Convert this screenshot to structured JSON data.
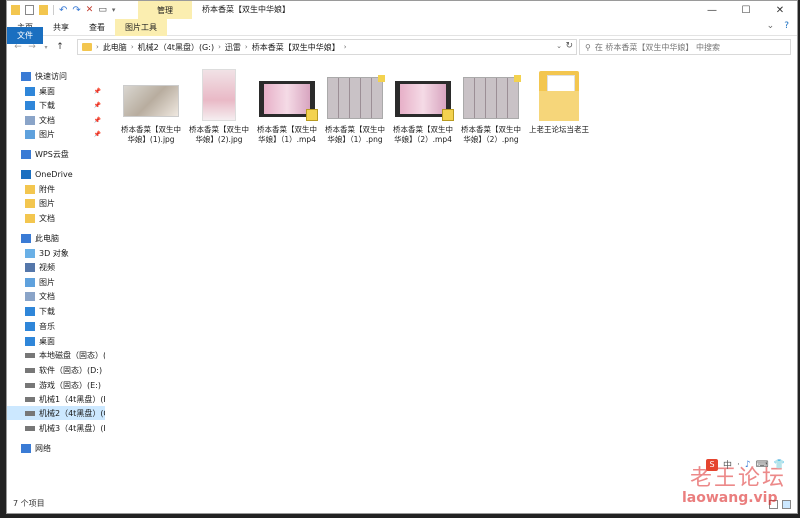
{
  "titlebar": {
    "manage_tab": "管理",
    "title": "桥本香菜【双生中华娘】",
    "minimize": "—",
    "maximize": "☐",
    "close": "✕"
  },
  "ribbon": {
    "tabs": [
      "文件",
      "主页",
      "共享",
      "查看",
      "图片工具"
    ]
  },
  "address": {
    "crumbs": [
      "此电脑",
      "机械2（4t黑盘）(G:)",
      "迅雷",
      "桥本香菜【双生中华娘】"
    ],
    "search_placeholder": "在 桥本香菜【双生中华娘】 中搜索"
  },
  "sidebar": {
    "items": [
      {
        "label": "快速访问",
        "icon": "star-icon",
        "pinned": false
      },
      {
        "label": "桌面",
        "icon": "desktop-icon",
        "pinned": true
      },
      {
        "label": "下载",
        "icon": "download-icon",
        "pinned": true
      },
      {
        "label": "文档",
        "icon": "document-icon",
        "pinned": true
      },
      {
        "label": "图片",
        "icon": "picture-icon",
        "pinned": true
      },
      {
        "label": "WPS云盘",
        "icon": "cloud-icon",
        "pinned": false
      },
      {
        "label": "OneDrive",
        "icon": "onedrive-icon",
        "pinned": false
      },
      {
        "label": "附件",
        "icon": "folder-icon",
        "pinned": false
      },
      {
        "label": "图片",
        "icon": "folder-icon",
        "pinned": false
      },
      {
        "label": "文档",
        "icon": "folder-icon",
        "pinned": false
      },
      {
        "label": "此电脑",
        "icon": "computer-icon",
        "pinned": false
      },
      {
        "label": "3D 对象",
        "icon": "cube-icon",
        "pinned": false
      },
      {
        "label": "视频",
        "icon": "video-icon",
        "pinned": false
      },
      {
        "label": "图片",
        "icon": "picture-icon",
        "pinned": false
      },
      {
        "label": "文档",
        "icon": "document-icon",
        "pinned": false
      },
      {
        "label": "下载",
        "icon": "download-icon",
        "pinned": false
      },
      {
        "label": "音乐",
        "icon": "music-icon",
        "pinned": false
      },
      {
        "label": "桌面",
        "icon": "desktop-icon",
        "pinned": false
      },
      {
        "label": "本地磁盘（固态）(",
        "icon": "drive-icon",
        "pinned": false
      },
      {
        "label": "软件（固态）(D:)",
        "icon": "drive-icon",
        "pinned": false
      },
      {
        "label": "游戏（固态）(E:)",
        "icon": "drive-icon",
        "pinned": false
      },
      {
        "label": "机械1（4t黑盘）(F",
        "icon": "drive-icon",
        "pinned": false
      },
      {
        "label": "机械2（4t黑盘）(G",
        "icon": "drive-icon",
        "pinned": false
      },
      {
        "label": "机械3（4t黑盘）(H",
        "icon": "drive-icon",
        "pinned": false
      },
      {
        "label": "网络",
        "icon": "network-icon",
        "pinned": false
      }
    ]
  },
  "files": [
    {
      "name": "桥本香菜【双生中华娘】(1).jpg",
      "type": "image-wide"
    },
    {
      "name": "桥本香菜【双生中华娘】(2).jpg",
      "type": "image-tall"
    },
    {
      "name": "桥本香菜【双生中华娘】（1）.mp4",
      "type": "video"
    },
    {
      "name": "桥本香菜【双生中华娘】（1）.png",
      "type": "grid"
    },
    {
      "name": "桥本香菜【双生中华娘】（2）.mp4",
      "type": "video"
    },
    {
      "name": "桥本香菜【双生中华娘】（2）.png",
      "type": "grid"
    },
    {
      "name": "上老王论坛当老王",
      "type": "folder"
    }
  ],
  "status": {
    "count_text": "7 个项目"
  },
  "ime": {
    "logo": "S",
    "items": [
      "中",
      "·",
      "♪",
      "⌨",
      "👕"
    ]
  },
  "watermark": {
    "line1": "老王论坛",
    "line2": "laowang.vip"
  }
}
